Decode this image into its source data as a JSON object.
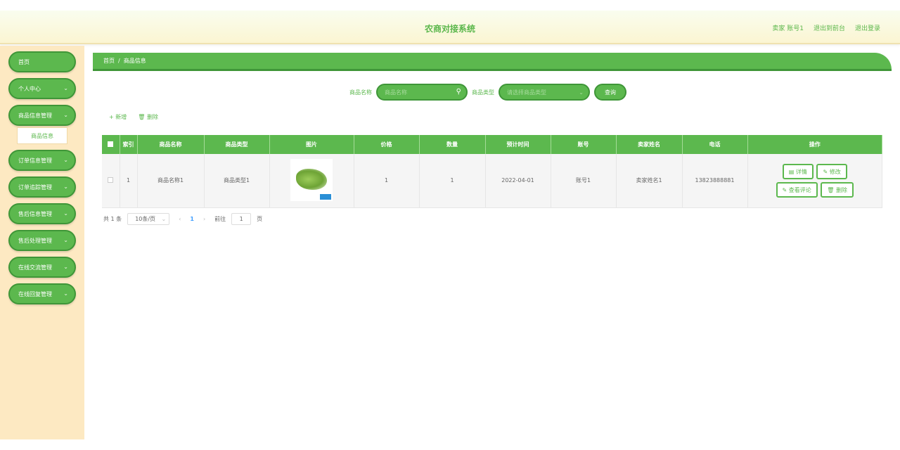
{
  "header": {
    "title": "农商对接系统",
    "user": "卖家 账号1",
    "front_link": "退出到前台",
    "logout_link": "退出登录"
  },
  "sidebar": {
    "items": [
      {
        "label": "首页",
        "chevron": false
      },
      {
        "label": "个人中心",
        "chevron": true
      },
      {
        "label": "商品信息管理",
        "chevron": true
      },
      {
        "label": "订单信息管理",
        "chevron": true
      },
      {
        "label": "订单追踪管理",
        "chevron": true
      },
      {
        "label": "售后信息管理",
        "chevron": true
      },
      {
        "label": "售后处理管理",
        "chevron": true
      },
      {
        "label": "在线交流管理",
        "chevron": true
      },
      {
        "label": "在线回复管理",
        "chevron": true
      }
    ],
    "sub_item": "商品信息"
  },
  "breadcrumb": {
    "home": "首页",
    "sep": "/",
    "current": "商品信息"
  },
  "search": {
    "name_label": "商品名称",
    "name_placeholder": "商品名称",
    "type_label": "商品类型",
    "type_placeholder": "请选择商品类型",
    "query_button": "查询"
  },
  "actions": {
    "add": "+ 新增",
    "delete": "删除"
  },
  "table": {
    "headers": [
      "索引",
      "商品名称",
      "商品类型",
      "图片",
      "价格",
      "数量",
      "预计时间",
      "账号",
      "卖家姓名",
      "电话",
      "操作"
    ],
    "rows": [
      {
        "index": "1",
        "name": "商品名称1",
        "type": "商品类型1",
        "price": "1",
        "qty": "1",
        "date": "2022-04-01",
        "account": "账号1",
        "seller": "卖家姓名1",
        "phone": "13823888881"
      }
    ],
    "ops": {
      "detail": "详情",
      "edit": "修改",
      "comments": "查看评论",
      "delete": "删除"
    }
  },
  "pager": {
    "total": "共 1 条",
    "page_size": "10条/页",
    "current": "1",
    "goto_label": "前往",
    "goto_value": "1",
    "page_unit": "页"
  },
  "colors": {
    "primary": "#5cb84e",
    "primary_dark": "#3f9638",
    "sidebar_bg": "#fde9c2"
  }
}
